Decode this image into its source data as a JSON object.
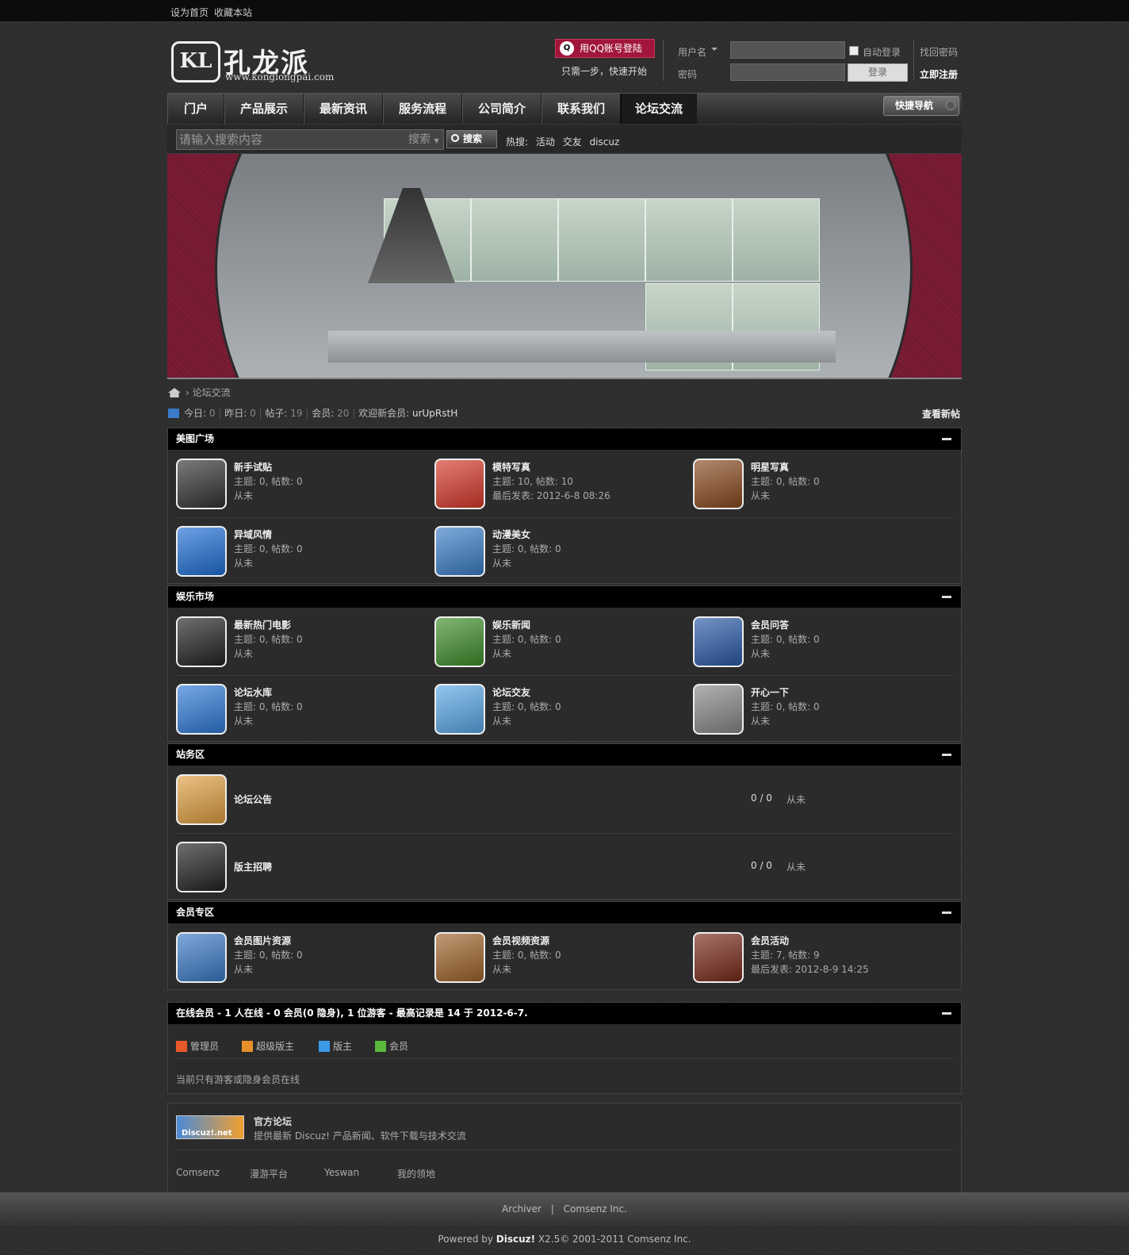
{
  "topbar": {
    "set_home": "设为首页",
    "bookmark": "收藏本站"
  },
  "logo": {
    "mark": "KL",
    "name": "孔龙派",
    "url": "www.konglongpai.com"
  },
  "login": {
    "qq_button": "用QQ账号登陆",
    "qq_tip": "只需一步，快速开始",
    "username_label": "用户名",
    "password_label": "密码",
    "auto_login": "自动登录",
    "forgot": "找回密码",
    "login_button": "登录",
    "register": "立即注册"
  },
  "nav": {
    "items": [
      "门户",
      "产品展示",
      "最新资讯",
      "服务流程",
      "公司简介",
      "联系我们",
      "论坛交流"
    ],
    "quick": "快捷导航"
  },
  "search": {
    "placeholder": "请输入搜索内容",
    "type": "搜索",
    "button": "搜索",
    "hot_label": "热搜:",
    "hot": [
      "活动",
      "交友",
      "discuz"
    ]
  },
  "breadcrumb": {
    "current": "论坛交流"
  },
  "stats": {
    "today_label": "今日:",
    "today": "0",
    "yesterday_label": "昨日:",
    "yesterday": "0",
    "posts_label": "帖子:",
    "posts": "19",
    "members_label": "会员:",
    "members": "20",
    "welcome_label": "欢迎新会员:",
    "welcome": "urUpRstH",
    "new_posts": "查看新帖"
  },
  "sections": [
    {
      "title": "美图广场",
      "forums": [
        {
          "name": "新手试贴",
          "meta": "主题: 0, 帖数: 0",
          "last": "从未",
          "color": "#333"
        },
        {
          "name": "模特写真",
          "meta": "主题: 10, 帖数: 10",
          "last": "最后发表: 2012-6-8 08:26",
          "color": "#d8382a"
        },
        {
          "name": "明星写真",
          "meta": "主题: 0, 帖数: 0",
          "last": "从未",
          "color": "#8a4a1e"
        },
        {
          "name": "异域风情",
          "meta": "主题: 0, 帖数: 0",
          "last": "从未",
          "color": "#1f6fd6"
        },
        {
          "name": "动漫美女",
          "meta": "主题: 0, 帖数: 0",
          "last": "从未",
          "color": "#3a7ec8"
        }
      ]
    },
    {
      "title": "娱乐市场",
      "forums": [
        {
          "name": "最新热门电影",
          "meta": "主题: 0, 帖数: 0",
          "last": "从未",
          "color": "#222"
        },
        {
          "name": "娱乐新闻",
          "meta": "主题: 0, 帖数: 0",
          "last": "从未",
          "color": "#3e8e2a"
        },
        {
          "name": "会员问答",
          "meta": "主题: 0, 帖数: 0",
          "last": "从未",
          "color": "#2a5aa8"
        },
        {
          "name": "论坛水库",
          "meta": "主题: 0, 帖数: 0",
          "last": "从未",
          "color": "#2f7ad8"
        },
        {
          "name": "论坛交友",
          "meta": "主题: 0, 帖数: 0",
          "last": "从未",
          "color": "#5aa8e8"
        },
        {
          "name": "开心一下",
          "meta": "主题: 0, 帖数: 0",
          "last": "从未",
          "color": "#888"
        }
      ]
    },
    {
      "title": "站务区",
      "forums": [
        {
          "name": "论坛公告",
          "count": "0 / 0",
          "last": "从未",
          "color": "#e0a040"
        },
        {
          "name": "版主招聘",
          "count": "0 / 0",
          "last": "从未",
          "color": "#222"
        }
      ]
    },
    {
      "title": "会员专区",
      "forums": [
        {
          "name": "会员图片资源",
          "meta": "主题: 0, 帖数: 0",
          "last": "从未",
          "color": "#3a7ac8"
        },
        {
          "name": "会员视频资源",
          "meta": "主题: 0, 帖数: 0",
          "last": "从未",
          "color": "#a0642a"
        },
        {
          "name": "会员活动",
          "meta": "主题: 7, 帖数: 9",
          "last": "最后发表: 2012-8-9 14:25",
          "color": "#7a2a1a"
        }
      ]
    }
  ],
  "online": {
    "title": "在线会员 - 1 人在线 - 0 会员(0 隐身), 1 位游客 - 最高记录是 14 于 2012-6-7.",
    "legend": [
      {
        "label": "管理员",
        "color": "#e85a2a"
      },
      {
        "label": "超级版主",
        "color": "#e8902a"
      },
      {
        "label": "版主",
        "color": "#3a9ae8"
      },
      {
        "label": "会员",
        "color": "#5ab83a"
      }
    ],
    "note": "当前只有游客或隐身会员在线"
  },
  "links": {
    "logo_text": "Discuz!.net",
    "title": "官方论坛",
    "desc": "提供最新 Discuz! 产品新闻、软件下载与技术交流",
    "items": [
      "Comsenz",
      "漫游平台",
      "Yeswan",
      "我的领地"
    ]
  },
  "footer": {
    "archiver": "Archiver",
    "sep": "|",
    "company": "Comsenz Inc.",
    "powered_prefix": "Powered by ",
    "product": "Discuz!",
    "version": " X2.5",
    "copyright": "© 2001-2011 Comsenz Inc."
  }
}
